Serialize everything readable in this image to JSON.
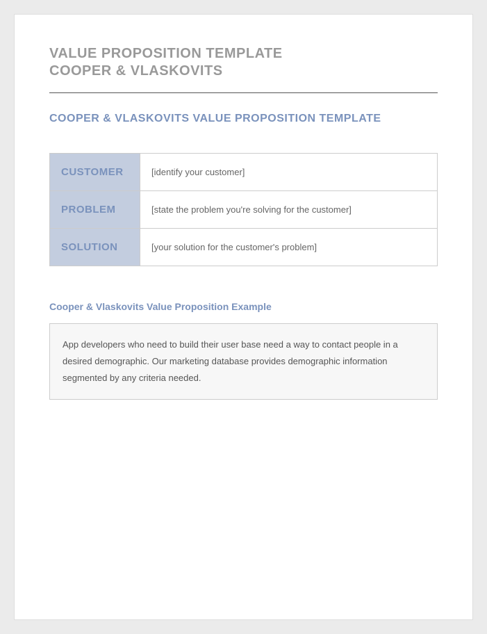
{
  "title": {
    "line1": "VALUE PROPOSITION TEMPLATE",
    "line2": "COOPER & VLASKOVITS"
  },
  "section_heading": "COOPER & VLASKOVITS VALUE PROPOSITION TEMPLATE",
  "table": {
    "rows": [
      {
        "label": "CUSTOMER",
        "value": "[identify your customer]"
      },
      {
        "label": "PROBLEM",
        "value": "[state the problem you're solving for the customer]"
      },
      {
        "label": "SOLUTION",
        "value": "[your solution for the customer's problem]"
      }
    ]
  },
  "example": {
    "heading": "Cooper & Vlaskovits Value Proposition Example",
    "body": "App developers who need to build their user base need a way to contact people in a desired demographic. Our marketing database provides demographic information segmented by any criteria needed."
  }
}
